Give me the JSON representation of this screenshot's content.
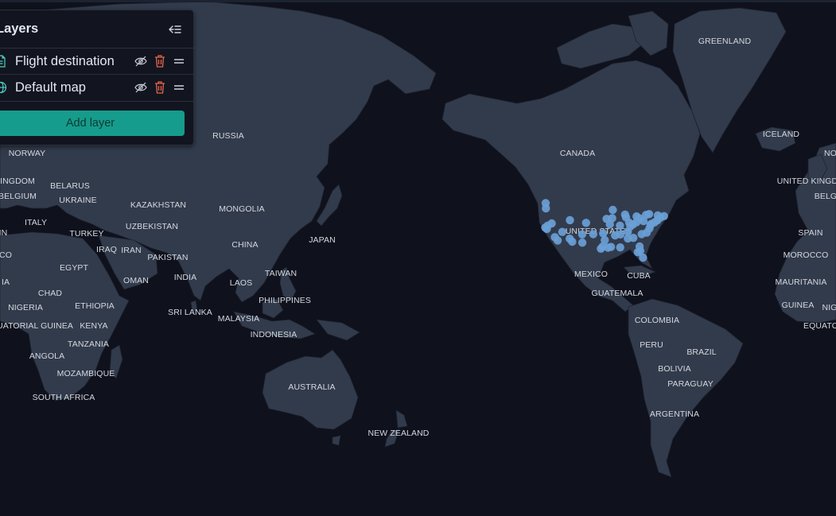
{
  "layers_panel": {
    "title": "Layers",
    "add_layer_label": "Add layer",
    "layers": [
      {
        "name": "Flight destination",
        "icon": "document-icon"
      },
      {
        "name": "Default map",
        "icon": "globe-icon"
      }
    ]
  },
  "map": {
    "labels": [
      "GREENLAND",
      "ICELAND",
      "NO",
      "UNITED KINGD",
      "BELG",
      "SPAIN",
      "MOROCCO",
      "MAURITANIA",
      "GUINEA",
      "NIG",
      "EQUATO",
      "CANADA",
      "UNITED STATES",
      "MEXICO",
      "CUBA",
      "GUATEMALA",
      "COLOMBIA",
      "PERU",
      "BRAZIL",
      "BOLIVIA",
      "PARAGUAY",
      "ARGENTINA",
      "RUSSIA",
      "NORWAY",
      "INGDOM",
      "BELARUS",
      "BELGIUM",
      "UKRAINE",
      "KAZAKHSTAN",
      "MONGOLIA",
      "ITALY",
      "TURKEY",
      "UZBEKISTAN",
      "JAPAN",
      "CHINA",
      "IRAQ",
      "IRAN",
      "PAKISTAN",
      "CO",
      "EGYPT",
      "OMAN",
      "INDIA",
      "TAIWAN",
      "LAOS",
      "IA",
      "CHAD",
      "PHILIPPINES",
      "NIGERIA",
      "ETHIOPIA",
      "SRI LANKA",
      "MALAYSIA",
      "UATORIAL GUINEA",
      "KENYA",
      "INDONESIA",
      "TANZANIA",
      "ANGOLA",
      "MOZAMBIQUE",
      "SOUTH AFRICA",
      "AUSTRALIA",
      "NEW ZEALAND",
      "IN"
    ],
    "colors": {
      "ocean": "#0f111c",
      "land": "#323b4c",
      "borders": "#1d2330",
      "points": "#6a9fd6",
      "accent_button": "#169c8c",
      "delete_icon": "#e7664c"
    },
    "flight_destinations": {
      "series_name": "Flight destination",
      "points": [
        [
          -122.4,
          47.6
        ],
        [
          -122.3,
          45.5
        ],
        [
          -122.6,
          37.8
        ],
        [
          -121.9,
          37.3
        ],
        [
          -121.5,
          38.6
        ],
        [
          -118.4,
          34.0
        ],
        [
          -117.2,
          32.7
        ],
        [
          -119.8,
          39.5
        ],
        [
          -115.2,
          36.1
        ],
        [
          -112.0,
          33.4
        ],
        [
          -111.9,
          40.8
        ],
        [
          -106.6,
          35.1
        ],
        [
          -104.9,
          39.7
        ],
        [
          -110.9,
          32.2
        ],
        [
          -97.7,
          30.3
        ],
        [
          -96.8,
          32.8
        ],
        [
          -95.4,
          29.8
        ],
        [
          -98.5,
          29.4
        ],
        [
          -90.1,
          29.9
        ],
        [
          -97.5,
          35.5
        ],
        [
          -94.6,
          39.1
        ],
        [
          -90.2,
          38.6
        ],
        [
          -93.3,
          44.9
        ],
        [
          -87.6,
          41.9
        ],
        [
          -88.0,
          43.0
        ],
        [
          -83.0,
          42.3
        ],
        [
          -86.2,
          39.8
        ],
        [
          -84.5,
          39.1
        ],
        [
          -83.0,
          40.0
        ],
        [
          -81.7,
          41.5
        ],
        [
          -80.0,
          40.4
        ],
        [
          -84.4,
          33.7
        ],
        [
          -86.8,
          36.2
        ],
        [
          -90.0,
          35.1
        ],
        [
          -86.8,
          33.5
        ],
        [
          -81.7,
          30.3
        ],
        [
          -82.5,
          28.0
        ],
        [
          -81.4,
          28.5
        ],
        [
          -80.2,
          25.8
        ],
        [
          -80.8,
          35.2
        ],
        [
          -78.6,
          35.8
        ],
        [
          -77.4,
          37.5
        ],
        [
          -77.0,
          38.9
        ],
        [
          -76.6,
          39.3
        ],
        [
          -75.2,
          39.9
        ],
        [
          -74.0,
          40.7
        ],
        [
          -73.8,
          42.7
        ],
        [
          -71.1,
          42.4
        ],
        [
          -72.7,
          41.8
        ],
        [
          -78.9,
          42.9
        ],
        [
          -77.6,
          43.2
        ],
        [
          -92.3,
          34.7
        ],
        [
          -94.1,
          30.1
        ],
        [
          -106.5,
          31.8
        ],
        [
          -101.8,
          35.2
        ],
        [
          -96.0,
          41.3
        ],
        [
          -93.6,
          41.6
        ],
        [
          -85.7,
          38.3
        ]
      ]
    }
  }
}
